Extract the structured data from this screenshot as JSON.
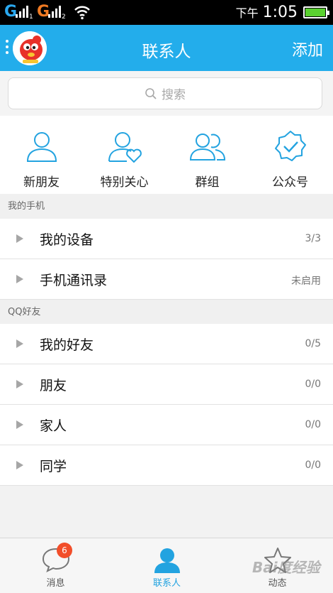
{
  "status_bar": {
    "network1": "G",
    "network2": "G",
    "sim1": "1",
    "sim2": "2",
    "ampm": "下午",
    "time": "1:05"
  },
  "header": {
    "title": "联系人",
    "add_label": "添加"
  },
  "search": {
    "placeholder": "搜索"
  },
  "quick_actions": [
    {
      "label": "新朋友",
      "icon": "person-icon"
    },
    {
      "label": "特别关心",
      "icon": "person-heart-icon"
    },
    {
      "label": "群组",
      "icon": "group-icon"
    },
    {
      "label": "公众号",
      "icon": "verified-badge-icon"
    }
  ],
  "groups": [
    {
      "header": "我的手机",
      "rows": [
        {
          "name": "我的设备",
          "count": "3/3"
        },
        {
          "name": "手机通讯录",
          "count": "未启用"
        }
      ]
    },
    {
      "header": "QQ好友",
      "rows": [
        {
          "name": "我的好友",
          "count": "0/5"
        },
        {
          "name": "朋友",
          "count": "0/0"
        },
        {
          "name": "家人",
          "count": "0/0"
        },
        {
          "name": "同学",
          "count": "0/0"
        }
      ]
    }
  ],
  "tabbar": {
    "tabs": [
      {
        "label": "消息",
        "badge": "6"
      },
      {
        "label": "联系人"
      },
      {
        "label": "动态"
      }
    ]
  },
  "watermark": {
    "text": "Bai度经验"
  },
  "colors": {
    "header_bg": "#23adeb",
    "accent": "#23a3e0",
    "badge": "#f24e2a",
    "battery": "#5ad130"
  }
}
